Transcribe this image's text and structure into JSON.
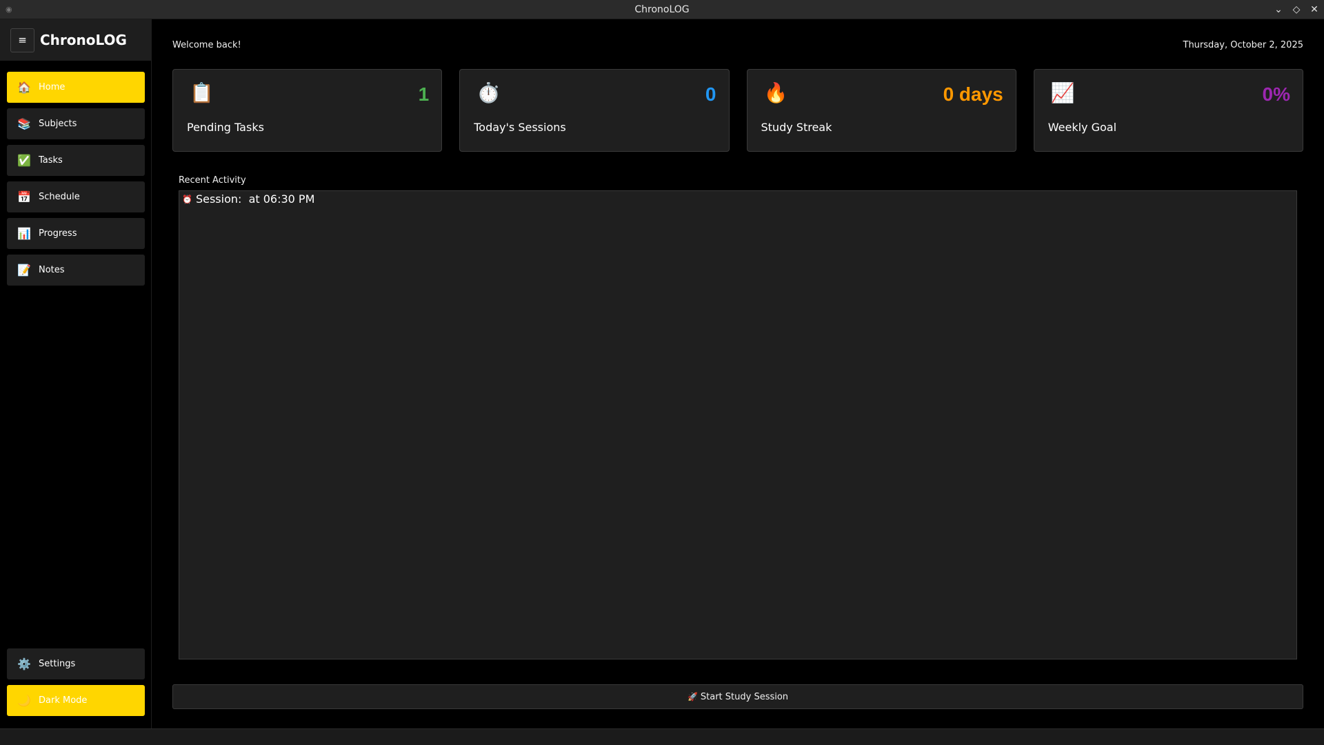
{
  "window": {
    "title": "ChronoLOG"
  },
  "sidebar": {
    "brand": "ChronoLOG",
    "menu_icon": "hamburger-icon",
    "items": [
      {
        "label": "Home",
        "icon": "🏠",
        "active": true
      },
      {
        "label": "Subjects",
        "icon": "📚",
        "active": false
      },
      {
        "label": "Tasks",
        "icon": "✅",
        "active": false
      },
      {
        "label": "Schedule",
        "icon": "📅",
        "active": false
      },
      {
        "label": "Progress",
        "icon": "📊",
        "active": false
      },
      {
        "label": "Notes",
        "icon": "📝",
        "active": false
      }
    ],
    "settings": {
      "label": "Settings",
      "icon": "⚙️"
    },
    "dark_mode": {
      "label": "Dark Mode",
      "icon": "🌙"
    }
  },
  "header": {
    "welcome": "Welcome back!",
    "date": "Thursday, October 2, 2025"
  },
  "cards": [
    {
      "icon": "📋",
      "value": "1",
      "label": "Pending Tasks",
      "color": "#4caf50"
    },
    {
      "icon": "⏱️",
      "value": "0",
      "label": "Today's Sessions",
      "color": "#2196f3"
    },
    {
      "icon": "🔥",
      "value": "0 days",
      "label": "Study Streak",
      "color": "#ff9800"
    },
    {
      "icon": "📈",
      "value": "0%",
      "label": "Weekly Goal",
      "color": "#9c27b0"
    }
  ],
  "recent": {
    "label": "Recent Activity",
    "items": [
      {
        "icon": "⏰",
        "text": "Session:  at 06:30 PM"
      }
    ]
  },
  "start_button": {
    "icon": "🚀",
    "label": "Start Study Session"
  },
  "colors": {
    "accent": "#ffd600",
    "surface": "#1f1f1f",
    "background": "#000000"
  }
}
